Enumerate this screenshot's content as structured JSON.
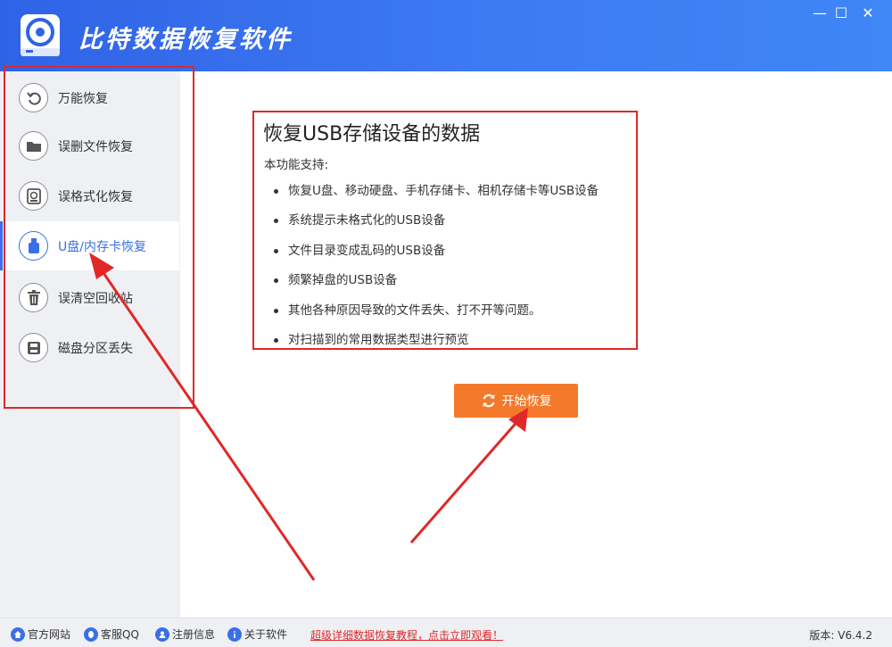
{
  "app": {
    "title": "比特数据恢复软件",
    "window_controls": {
      "minimize": "—",
      "maximize": "☐",
      "close": "✕"
    }
  },
  "sidebar": {
    "items": [
      {
        "label": "万能恢复",
        "icon": "undo-icon"
      },
      {
        "label": "误删文件恢复",
        "icon": "folder-icon"
      },
      {
        "label": "误格式化恢复",
        "icon": "format-disk-icon"
      },
      {
        "label": "U盘/内存卡恢复",
        "icon": "usb-drive-icon",
        "active": true
      },
      {
        "label": "误清空回收站",
        "icon": "trash-icon"
      },
      {
        "label": "磁盘分区丢失",
        "icon": "disk-partition-icon"
      }
    ]
  },
  "main": {
    "title": "恢复USB存储设备的数据",
    "subtitle": "本功能支持:",
    "features": [
      "恢复U盘、移动硬盘、手机存储卡、相机存储卡等USB设备",
      "系统提示未格式化的USB设备",
      "文件目录变成乱码的USB设备",
      "频繁掉盘的USB设备",
      "其他各种原因导致的文件丢失、打不开等问题。",
      "对扫描到的常用数据类型进行预览"
    ],
    "start_button": "开始恢复"
  },
  "footer": {
    "links": [
      {
        "label": "官方网站",
        "icon": "home-icon"
      },
      {
        "label": "客服QQ",
        "icon": "qq-icon"
      },
      {
        "label": "注册信息",
        "icon": "register-icon"
      },
      {
        "label": "关于软件",
        "icon": "info-icon"
      }
    ],
    "tutorial": "超级详细数据恢复教程，点击立即观看！",
    "version": "版本: V6.4.2"
  },
  "colors": {
    "titlebar": "#3d7af2",
    "accent": "#3b6fe8",
    "start_button": "#f5792a",
    "annotation": "#e02828"
  }
}
